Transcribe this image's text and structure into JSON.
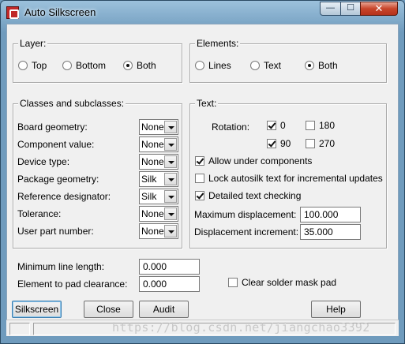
{
  "window": {
    "title": "Auto Silkscreen",
    "min_label": "—",
    "max_label": "☐",
    "close_label": "✕"
  },
  "layer": {
    "legend": "Layer:",
    "options": [
      {
        "label": "Top",
        "selected": false
      },
      {
        "label": "Bottom",
        "selected": false
      },
      {
        "label": "Both",
        "selected": true
      }
    ]
  },
  "elements": {
    "legend": "Elements:",
    "options": [
      {
        "label": "Lines",
        "selected": false
      },
      {
        "label": "Text",
        "selected": false
      },
      {
        "label": "Both",
        "selected": true
      }
    ]
  },
  "classes": {
    "legend": "Classes and subclasses:",
    "rows": [
      {
        "label": "Board geometry:",
        "value": "None"
      },
      {
        "label": "Component value:",
        "value": "None"
      },
      {
        "label": "Device type:",
        "value": "None"
      },
      {
        "label": "Package geometry:",
        "value": "Silk"
      },
      {
        "label": "Reference designator:",
        "value": "Silk"
      },
      {
        "label": "Tolerance:",
        "value": "None"
      },
      {
        "label": "User part number:",
        "value": "None"
      }
    ]
  },
  "text": {
    "legend": "Text:",
    "rotation_label": "Rotation:",
    "rotations": [
      {
        "label": "0",
        "checked": true
      },
      {
        "label": "180",
        "checked": false
      },
      {
        "label": "90",
        "checked": true
      },
      {
        "label": "270",
        "checked": false
      }
    ],
    "allow_under": {
      "label": "Allow under components",
      "checked": true
    },
    "lock_autosilk": {
      "label": "Lock autosilk text for incremental updates",
      "checked": false
    },
    "detailed_check": {
      "label": "Detailed text checking",
      "checked": true
    },
    "max_disp": {
      "label": "Maximum displacement:",
      "value": "100.000"
    },
    "disp_incr": {
      "label": "Displacement increment:",
      "value": "35.000"
    }
  },
  "bottom": {
    "min_line": {
      "label": "Minimum line length:",
      "value": "0.000"
    },
    "pad_clearance": {
      "label": "Element to pad clearance:",
      "value": "0.000"
    },
    "clear_mask": {
      "label": "Clear solder mask pad",
      "checked": false
    }
  },
  "buttons": {
    "silkscreen": "Silkscreen",
    "close": "Close",
    "audit": "Audit",
    "help": "Help"
  },
  "watermark": "https://blog.csdn.net/jiangchao3392"
}
